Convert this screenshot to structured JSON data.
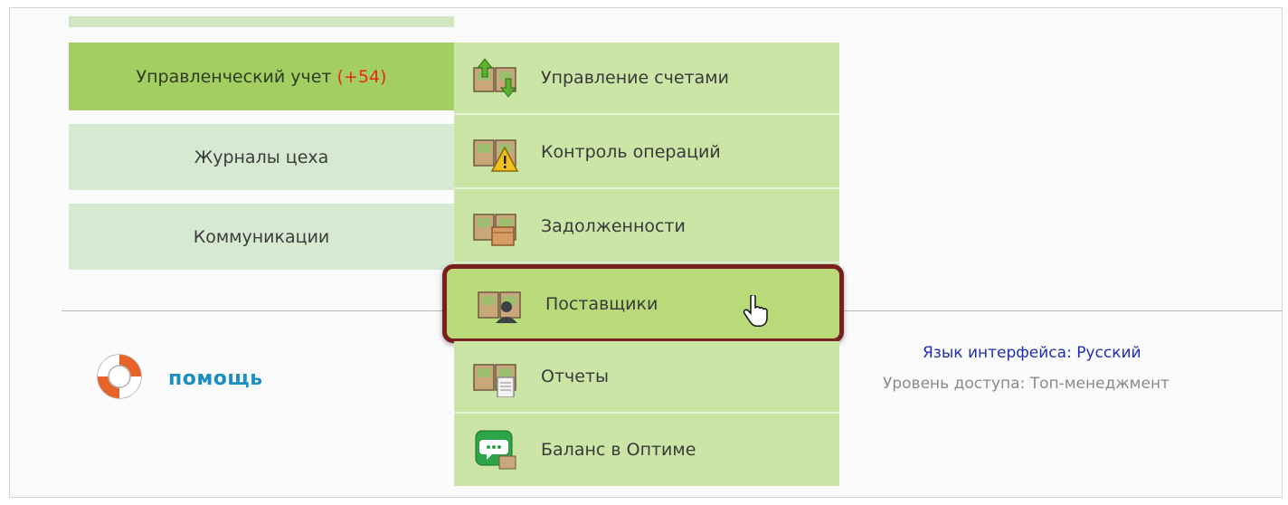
{
  "left_menu": {
    "items": [
      {
        "label": "Управленческий учет",
        "badge": "(+54)"
      },
      {
        "label": "Журналы цеха"
      },
      {
        "label": "Коммуникации"
      }
    ]
  },
  "submenu": {
    "items": [
      {
        "label": "Управление счетами",
        "icon": "accounts-transfer-icon"
      },
      {
        "label": "Контроль операций",
        "icon": "operations-warning-icon"
      },
      {
        "label": "Задолженности",
        "icon": "debts-box-icon"
      },
      {
        "label": "Поставщики",
        "icon": "suppliers-person-icon"
      },
      {
        "label": "Отчеты",
        "icon": "reports-document-icon"
      },
      {
        "label": "Баланс в Оптиме",
        "icon": "chat-balance-icon"
      }
    ],
    "highlighted_index": 3
  },
  "help": {
    "label": "помощь"
  },
  "footer_info": {
    "language": "Язык интерфейса: Русский",
    "access_level": "Уровень доступа: Топ-менеджмент"
  },
  "colors": {
    "active_tab": "#a3cf62",
    "inactive_tab": "#d6ead2",
    "submenu_bg": "#cbe5a7",
    "highlight_border": "#7a1f20",
    "badge": "#e8281e",
    "help_text": "#1b8fc2",
    "lang_link": "#1f2fb4"
  }
}
